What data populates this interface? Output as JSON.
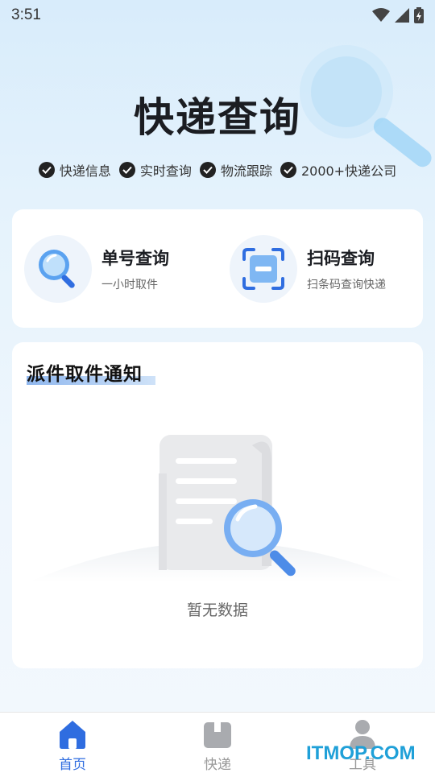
{
  "status_bar": {
    "time": "3:51"
  },
  "header": {
    "title": "快递查询",
    "features": [
      "快递信息",
      "实时查询",
      "物流跟踪",
      "2000+快递公司"
    ]
  },
  "quick_actions": [
    {
      "title": "单号查询",
      "subtitle": "一小时取件"
    },
    {
      "title": "扫码查询",
      "subtitle": "扫条码查询快递"
    }
  ],
  "notice": {
    "title": "派件取件通知",
    "empty_text": "暂无数据"
  },
  "tabbar": {
    "tabs": [
      {
        "label": "首页",
        "icon": "home-icon",
        "active": true
      },
      {
        "label": "快递",
        "icon": "package-icon",
        "active": false
      },
      {
        "label": "工具",
        "icon": "user-icon",
        "active": false
      }
    ]
  },
  "watermark": "ITMOP.COM",
  "colors": {
    "accent": "#2f6de0",
    "inactive": "#999999"
  }
}
